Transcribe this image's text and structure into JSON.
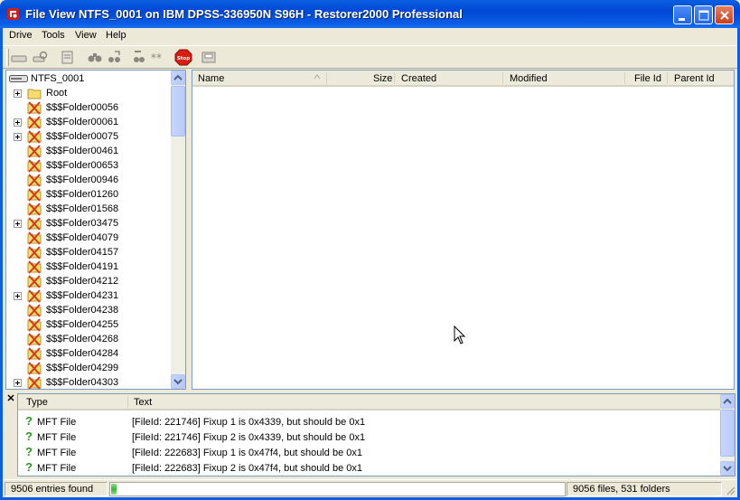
{
  "window": {
    "title": "File View NTFS_0001 on IBM DPSS-336950N S96H - Restorer2000 Professional"
  },
  "menu": [
    {
      "label": "Drive"
    },
    {
      "label": "Tools"
    },
    {
      "label": "View"
    },
    {
      "label": "Help"
    }
  ],
  "toolbar": {
    "icons": [
      "drive-icon",
      "drive-search-icon",
      "open-file-icon",
      "find-icon",
      "find-next-icon",
      "mark-icon",
      "mark-all-icon",
      "stop-icon",
      "save-icon"
    ],
    "stop_label": "Stop"
  },
  "tree": {
    "root_label": "NTFS_0001",
    "items": [
      {
        "label": "Root",
        "expandable": true,
        "icon": "folder-icon"
      },
      {
        "label": "$$$Folder00056",
        "expandable": false,
        "icon": "lost-folder-icon"
      },
      {
        "label": "$$$Folder00061",
        "expandable": true,
        "icon": "lost-folder-icon"
      },
      {
        "label": "$$$Folder00075",
        "expandable": true,
        "icon": "lost-folder-icon"
      },
      {
        "label": "$$$Folder00461",
        "expandable": false,
        "icon": "lost-folder-icon"
      },
      {
        "label": "$$$Folder00653",
        "expandable": false,
        "icon": "lost-folder-icon"
      },
      {
        "label": "$$$Folder00946",
        "expandable": false,
        "icon": "lost-folder-icon"
      },
      {
        "label": "$$$Folder01260",
        "expandable": false,
        "icon": "lost-folder-icon"
      },
      {
        "label": "$$$Folder01568",
        "expandable": false,
        "icon": "lost-folder-icon"
      },
      {
        "label": "$$$Folder03475",
        "expandable": true,
        "icon": "lost-folder-icon"
      },
      {
        "label": "$$$Folder04079",
        "expandable": false,
        "icon": "lost-folder-icon"
      },
      {
        "label": "$$$Folder04157",
        "expandable": false,
        "icon": "lost-folder-icon"
      },
      {
        "label": "$$$Folder04191",
        "expandable": false,
        "icon": "lost-folder-icon"
      },
      {
        "label": "$$$Folder04212",
        "expandable": false,
        "icon": "lost-folder-icon"
      },
      {
        "label": "$$$Folder04231",
        "expandable": true,
        "icon": "lost-folder-icon"
      },
      {
        "label": "$$$Folder04238",
        "expandable": false,
        "icon": "lost-folder-icon"
      },
      {
        "label": "$$$Folder04255",
        "expandable": false,
        "icon": "lost-folder-icon"
      },
      {
        "label": "$$$Folder04268",
        "expandable": false,
        "icon": "lost-folder-icon"
      },
      {
        "label": "$$$Folder04284",
        "expandable": false,
        "icon": "lost-folder-icon"
      },
      {
        "label": "$$$Folder04299",
        "expandable": false,
        "icon": "lost-folder-icon"
      },
      {
        "label": "$$$Folder04303",
        "expandable": true,
        "icon": "lost-folder-icon"
      }
    ]
  },
  "file_list": {
    "columns": [
      "Name",
      "Size",
      "Created",
      "Modified",
      "File Id",
      "Parent Id"
    ],
    "rows": []
  },
  "log": {
    "columns": [
      "Type",
      "Text"
    ],
    "rows": [
      {
        "type": "MFT File",
        "text": "[FileId: 221746] Fixup 1 is 0x4339, but should be 0x1"
      },
      {
        "type": "MFT File",
        "text": "[FileId: 221746] Fixup 2 is 0x4339, but should be 0x1"
      },
      {
        "type": "MFT File",
        "text": "[FileId: 222683] Fixup 1 is 0x47f4, but should be 0x1"
      },
      {
        "type": "MFT File",
        "text": "[FileId: 222683] Fixup 2 is 0x47f4, but should be 0x1"
      }
    ]
  },
  "status": {
    "entries": "9506 entries found",
    "progress_fraction": 0.004,
    "summary": "9056 files, 531 folders"
  },
  "colors": {
    "title_bar": "#0b5ee6",
    "lost_folder_cross": "#d03a1a",
    "log_question": "#2a9a1a"
  }
}
